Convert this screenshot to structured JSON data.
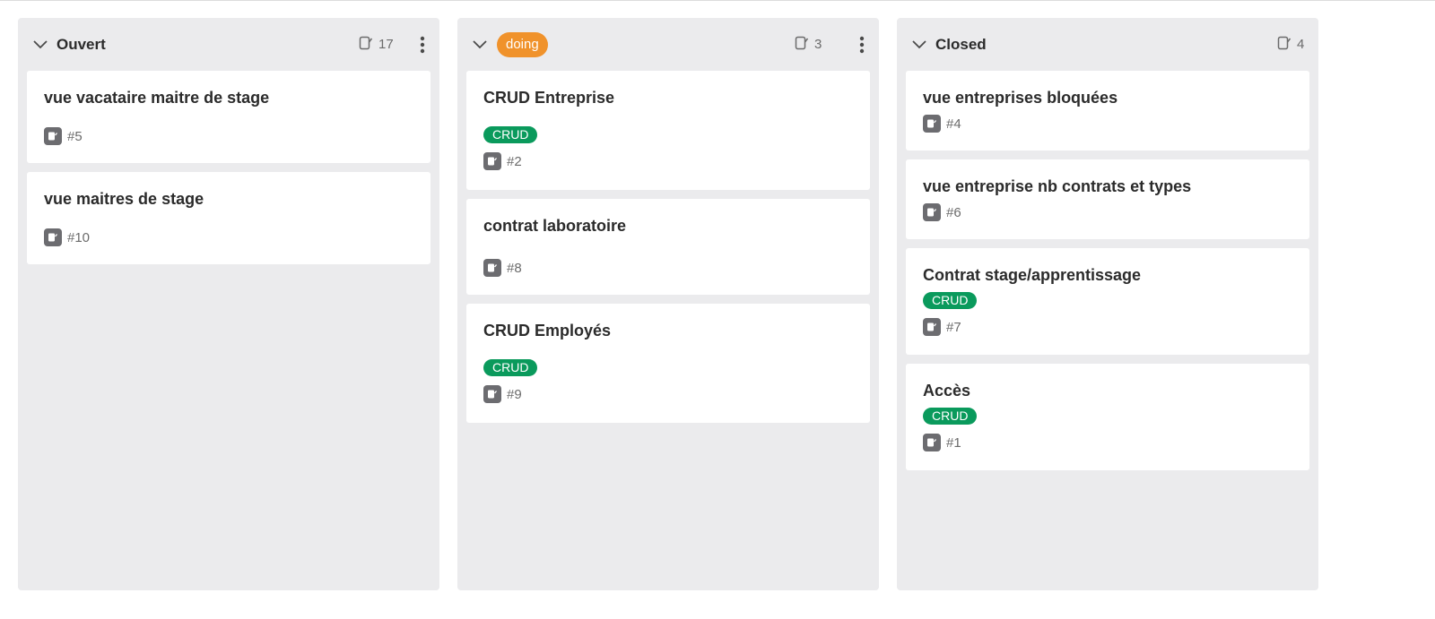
{
  "columns": [
    {
      "title": "Ouvert",
      "badge": "",
      "count": "17",
      "cards": [
        {
          "title": "vue vacataire maitre de stage",
          "label": "",
          "ref": "#5"
        },
        {
          "title": "vue maitres de stage",
          "label": "",
          "ref": "#10"
        }
      ]
    },
    {
      "title": "",
      "badge": "doing",
      "count": "3",
      "cards": [
        {
          "title": "CRUD Entreprise",
          "label": "CRUD",
          "ref": "#2"
        },
        {
          "title": "contrat laboratoire",
          "label": "",
          "ref": "#8"
        },
        {
          "title": "CRUD Employés",
          "label": "CRUD",
          "ref": "#9"
        }
      ]
    },
    {
      "title": "Closed",
      "badge": "",
      "count": "4",
      "cards": [
        {
          "title": "vue entreprises bloquées",
          "label": "",
          "ref": "#4"
        },
        {
          "title": "vue entreprise nb contrats et types",
          "label": "",
          "ref": "#6"
        },
        {
          "title": "Contrat stage/apprentissage",
          "label": "CRUD",
          "ref": "#7"
        },
        {
          "title": "Accès",
          "label": "CRUD",
          "ref": "#1"
        }
      ]
    }
  ],
  "colors": {
    "doing_badge": "#f0922b",
    "crud_label": "#0a9a5c",
    "column_bg": "#ebebed"
  },
  "icons": {
    "collapse": "chevron-down-icon",
    "issue_count": "issue-count-icon",
    "menu": "kebab-menu-icon",
    "issue": "issue-icon"
  }
}
